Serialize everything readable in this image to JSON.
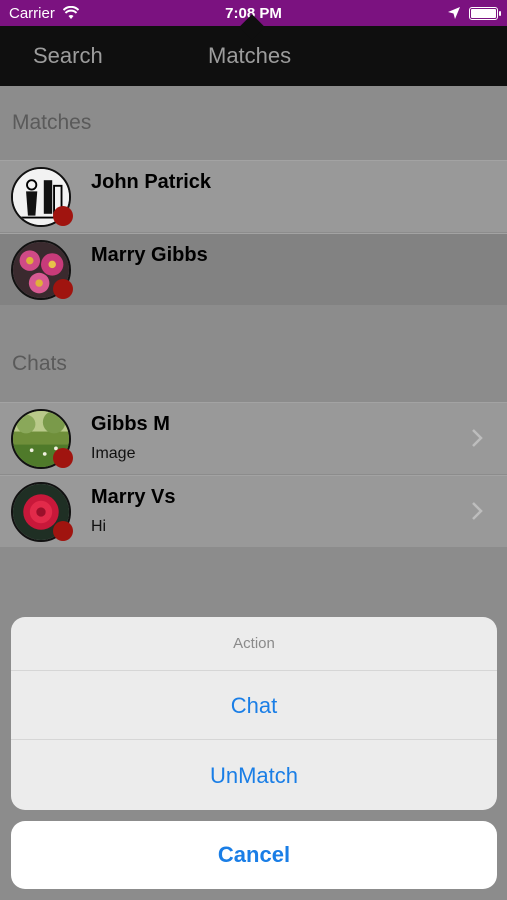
{
  "status_bar": {
    "carrier": "Carrier",
    "time": "7:08 PM",
    "background_color": "#7b1280",
    "icons": [
      "wifi-icon",
      "location-arrow-icon",
      "battery-icon"
    ]
  },
  "tab_bar": {
    "search_label": "Search",
    "matches_label": "Matches"
  },
  "matches_section": {
    "title": "Matches",
    "items": [
      {
        "name": "John Patrick",
        "avatar": "sketch-figures-avatar"
      },
      {
        "name": "Marry Gibbs",
        "avatar": "pink-flowers-avatar"
      }
    ]
  },
  "chats_section": {
    "title": "Chats",
    "items": [
      {
        "name": "Gibbs M",
        "last_message": "Image",
        "avatar": "garden-avatar"
      },
      {
        "name": "Marry Vs",
        "last_message": "Hi",
        "avatar": "red-flower-avatar"
      }
    ]
  },
  "action_sheet": {
    "title": "Action",
    "chat_label": "Chat",
    "unmatch_label": "UnMatch",
    "cancel_label": "Cancel",
    "button_color": "#1a7ee6"
  },
  "badge_color": "#a0140f"
}
